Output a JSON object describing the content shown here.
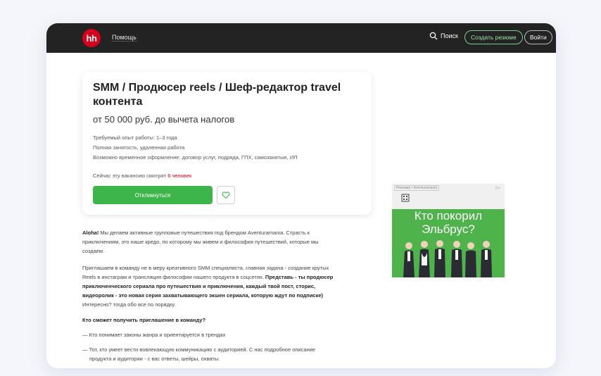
{
  "header": {
    "logo_text": "hh",
    "help_label": "Помощь",
    "search_label": "Поиск",
    "create_resume_label": "Создать резюме",
    "login_label": "Войти"
  },
  "vacancy": {
    "title": "SMM / Продюсер reels / Шеф-редактор travel контента",
    "salary": "от 50 000 руб. до вычета налогов",
    "experience": "Требуемый опыт работы: 1–3 года",
    "employment": "Полная занятость, удаленная работа",
    "registration": "Возможно временное оформление: договор услуг, подряда, ГПХ, самозанятые, ИП",
    "watching_prefix": "Сейчас эту вакансию смотрят ",
    "watching_count": "6 человек",
    "apply_label": "Откликнуться"
  },
  "description": {
    "p1_bold": "Aloha!",
    "p1_line1": " Мы делаем активные групповые путешествия под брендом Aventuramania. Страсть к",
    "p1_line2": "приключениям, это наше кредо, по которому мы живем и философия путешествий, которые мы",
    "p1_line3": "создаем.",
    "p2_line1": "Приглашаем в команду не в меру креативного SMM специалиста, главная задача - создание крутых",
    "p2_line2_plain": "Reels в инстаграм и трансляция философии нашего продукта в соцсетях. ",
    "p2_line2_bold": "Представь - ты продюсер",
    "p2_line3_bold": "приключенческого сериала про путешествия и приключения, каждый твой пост, сторис,",
    "p2_line4_bold": "видеоролик - это новая серия захватывающего экшен сериала, которую ждут по подписке)",
    "p2_line5": "Интересно? тогда обо все по порядку.",
    "question": "Кто сможет получить приглашение в команду?",
    "bullet1": "— Кто понимает законы жанра и ориентируется в трендах",
    "bullet2_line1": "— Тот, кто умеет вести вовлекающую коммуникацию с аудиторией. С нас подробное описание",
    "bullet2_line2": "продукта и аудитории - с вас ответы, шейры, охваты."
  },
  "ad": {
    "tag": "Реклама • Aventuramania",
    "plus": "0+",
    "headline_line1": "Кто покорил",
    "headline_line2": "Эльбрус?"
  },
  "colors": {
    "topbar": "#232323",
    "brand_red": "#d6001c",
    "apply_green": "#3eb54a",
    "ad_green": "#4db34a"
  },
  "icons": {
    "search": "search-icon",
    "favorite": "heart-icon"
  }
}
